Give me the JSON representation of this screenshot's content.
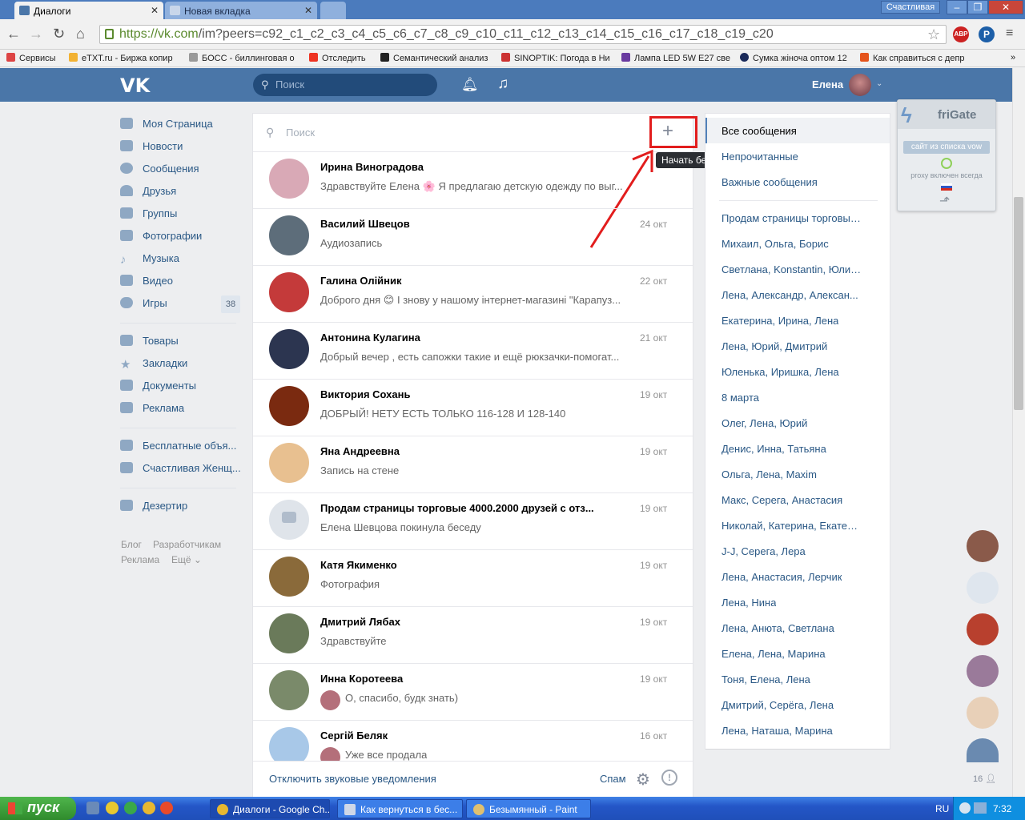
{
  "browser": {
    "tabs": [
      {
        "label": "Диалоги",
        "active": true
      },
      {
        "label": "Новая вкладка",
        "active": false
      }
    ],
    "profile": "Счастливая",
    "url_base": "https://vk.com",
    "url_rest": "/im?peers=c92_c1_c2_c3_c4_c5_c6_c7_c8_c9_c10_c11_c12_c13_c14_c15_c16_c17_c18_c19_c20",
    "bookmarks": [
      {
        "label": "Сервисы",
        "color": "#d44"
      },
      {
        "label": "eTXT.ru - Биржа копир",
        "color": "#f2b233"
      },
      {
        "label": "БОСС - биллинговая о",
        "color": "#999"
      },
      {
        "label": "Отследить",
        "color": "#e32"
      },
      {
        "label": "Семантический анализ",
        "color": "#222"
      },
      {
        "label": "SINOPTIK: Погода в Ни",
        "color": "#c33"
      },
      {
        "label": "Лампа LED 5W E27 све",
        "color": "#6a3ba0"
      },
      {
        "label": "Сумка жіноча оптом 12",
        "color": "#1a2a5a"
      },
      {
        "label": "Как справиться с депр",
        "color": "#e5541c"
      }
    ]
  },
  "vk": {
    "logo": "VK",
    "search_placeholder": "Поиск",
    "user_name": "Елена"
  },
  "left_menu": {
    "items": [
      {
        "label": "Моя Страница"
      },
      {
        "label": "Новости"
      },
      {
        "label": "Сообщения"
      },
      {
        "label": "Друзья"
      },
      {
        "label": "Группы"
      },
      {
        "label": "Фотографии"
      },
      {
        "label": "Музыка"
      },
      {
        "label": "Видео"
      },
      {
        "label": "Игры",
        "count": "38"
      },
      {
        "label": "Товары"
      },
      {
        "label": "Закладки"
      },
      {
        "label": "Документы"
      },
      {
        "label": "Реклама"
      },
      {
        "label": "Бесплатные объя..."
      },
      {
        "label": "Счастливая Женщ..."
      },
      {
        "label": "Дезертир"
      }
    ],
    "footer": {
      "blog": "Блог",
      "dev": "Разработчикам",
      "ads": "Реклама",
      "more": "Ещё ⌄"
    }
  },
  "messages": {
    "search_placeholder": "Поиск",
    "new_chat_plus": "+",
    "tooltip": "Начать беседу",
    "dialogs": [
      {
        "name": "Ирина Виноградова",
        "date": "",
        "text": "Здравствуйте Елена 🌸 Я предлагаю детскую одежду по выг...",
        "avatar": "#d9a9b6"
      },
      {
        "name": "Василий Швецов",
        "date": "24 окт",
        "text": "Аудиозапись",
        "avatar": "#5d6d7a"
      },
      {
        "name": "Галина Олійник",
        "date": "22 окт",
        "text": "Доброго дня 😊 І знову у нашому інтернет-магазині \"Карапуз...",
        "avatar": "#c43a3a"
      },
      {
        "name": "Антонина Кулагина",
        "date": "21 окт",
        "text": "Добрый вечер , есть сапожки такие и ещё рюкзачки-помогат...",
        "avatar": "#2c3550"
      },
      {
        "name": "Виктория Сохань",
        "date": "19 окт",
        "text": "ДОБРЫЙ! НЕТУ ЕСТЬ ТОЛЬКО 116-128 И 128-140",
        "avatar": "#7a2a10"
      },
      {
        "name": "Яна Андреевна",
        "date": "19 окт",
        "text": "Запись на стене",
        "avatar": "#e8c090"
      },
      {
        "name": "Продам страницы торговые 4000.2000 друзей с отз...",
        "date": "19 окт",
        "text": "Елена Шевцова покинула беседу",
        "avatar": "#dfe4ea"
      },
      {
        "name": "Катя Якименко",
        "date": "19 окт",
        "text": "Фотография",
        "avatar": "#8a6a3a"
      },
      {
        "name": "Дмитрий Лябах",
        "date": "19 окт",
        "text": "Здравствуйте",
        "avatar": "#6a7a5a"
      },
      {
        "name": "Инна Коротеева",
        "date": "19 окт",
        "text": "О, спасибо, будк знать)",
        "avatar": "#7a8a6a",
        "mini": true
      },
      {
        "name": "Сергій Беляк",
        "date": "16 окт",
        "text": "Уже все продала",
        "avatar": "#a8c8e8",
        "mini": true
      }
    ],
    "mute_label": "Отключить звуковые уведомления",
    "spam_label": "Спам",
    "info_glyph": "!"
  },
  "filters": {
    "all": "Все сообщения",
    "unread": "Непрочитанные",
    "important": "Важные сообщения",
    "chats": [
      "Продам страницы торговые...",
      "Михаил, Ольга, Борис",
      "Светлана, Konstantin, Юлиа...",
      "Лена, Александр, Алексан...",
      "Екатерина, Ирина, Лена",
      "Лена, Юрий, Дмитрий",
      "Юленька, Иришка, Лена",
      "8 марта",
      "Олег, Лена, Юрий",
      "Денис, Инна, Татьяна",
      "Ольга, Лена, Maxim",
      "Макс, Серега, Анастасия",
      "Николай, Катерина, Екатер...",
      "J-J, Серега, Лера",
      "Лена, Анастасия, Лерчик",
      "Лена, Нина",
      "Лена, Анюта, Светлана",
      "Елена, Лена, Марина",
      "Тоня, Елена, Лена",
      "Дмитрий, Серёга, Лена",
      "Лена, Наташа, Марина"
    ]
  },
  "frigate": {
    "title": "friGate",
    "site_list": "сайт из списка vow",
    "proxy": "proxy включен всегда"
  },
  "online_friends": {
    "count": "16"
  },
  "taskbar": {
    "start": "пуск",
    "items": [
      {
        "label": "Диалоги - Google Ch...",
        "color": "#e8b830"
      },
      {
        "label": "Как вернуться в бес...",
        "color": "#cfd8e8"
      },
      {
        "label": "Безымянный - Paint",
        "color": "#e0c070"
      }
    ],
    "lang": "RU",
    "time": "7:32"
  }
}
